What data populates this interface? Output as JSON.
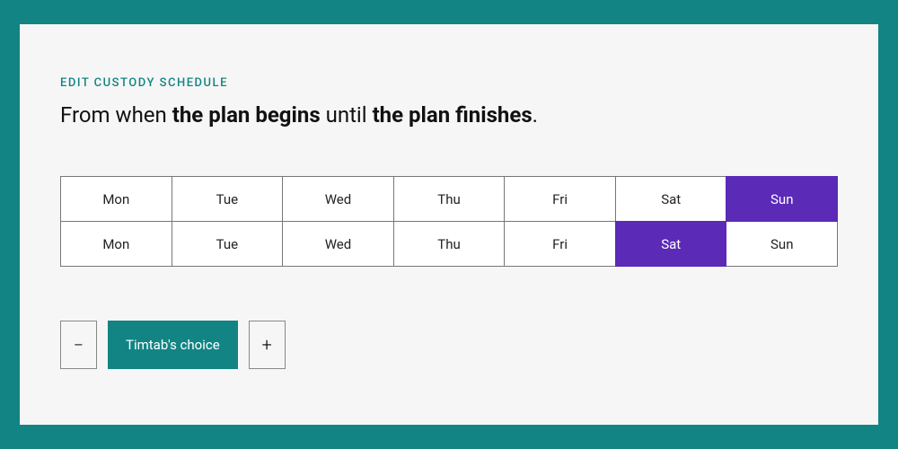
{
  "eyebrow": "EDIT CUSTODY SCHEDULE",
  "headline": {
    "p1": "From when ",
    "b1": "the plan begins",
    "p2": " until ",
    "b2": "the plan finishes",
    "p3": "."
  },
  "grid": {
    "rows": [
      {
        "cells": [
          {
            "label": "Mon",
            "selected": false
          },
          {
            "label": "Tue",
            "selected": false
          },
          {
            "label": "Wed",
            "selected": false
          },
          {
            "label": "Thu",
            "selected": false
          },
          {
            "label": "Fri",
            "selected": false
          },
          {
            "label": "Sat",
            "selected": false
          },
          {
            "label": "Sun",
            "selected": true
          }
        ]
      },
      {
        "cells": [
          {
            "label": "Mon",
            "selected": false
          },
          {
            "label": "Tue",
            "selected": false
          },
          {
            "label": "Wed",
            "selected": false
          },
          {
            "label": "Thu",
            "selected": false
          },
          {
            "label": "Fri",
            "selected": false
          },
          {
            "label": "Sat",
            "selected": true
          },
          {
            "label": "Sun",
            "selected": false
          }
        ]
      }
    ]
  },
  "controls": {
    "decrement": "−",
    "primary": "Timtab's choice",
    "increment": "+"
  },
  "colors": {
    "brand": "#128484",
    "accent": "#5b2ab7",
    "panel": "#f6f6f6"
  }
}
